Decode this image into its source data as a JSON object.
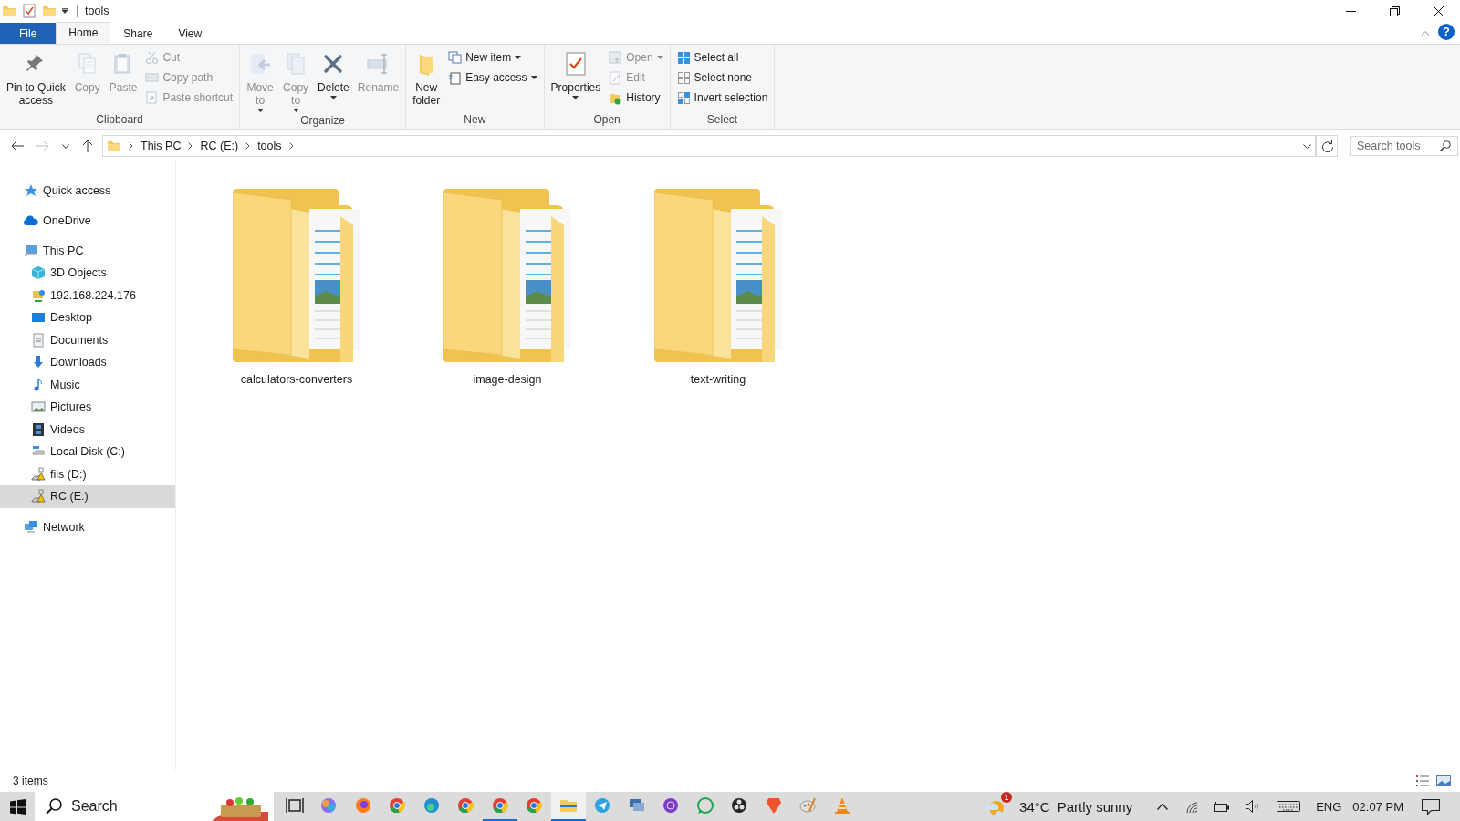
{
  "window": {
    "title": "tools"
  },
  "ribbon_tabs": [
    {
      "label": "File",
      "kind": "file",
      "selected": false
    },
    {
      "label": "Home",
      "kind": "tab",
      "selected": true
    },
    {
      "label": "Share",
      "kind": "tab",
      "selected": false
    },
    {
      "label": "View",
      "kind": "tab",
      "selected": false
    }
  ],
  "help_button": {
    "label": "?"
  },
  "ribbon_groups": [
    {
      "label": "Clipboard",
      "items": [
        {
          "kind": "large",
          "label": "Pin to Quick\naccess",
          "disabled": false,
          "dropdown": false
        },
        {
          "kind": "large",
          "label": "Copy",
          "disabled": true,
          "dropdown": false
        },
        {
          "kind": "large",
          "label": "Paste",
          "disabled": true,
          "dropdown": false
        },
        {
          "kind": "stack",
          "items": [
            {
              "label": "Cut",
              "disabled": true,
              "dropdown": false
            },
            {
              "label": "Copy path",
              "disabled": true,
              "dropdown": false
            },
            {
              "label": "Paste shortcut",
              "disabled": true,
              "dropdown": false
            }
          ]
        }
      ]
    },
    {
      "label": "Organize",
      "items": [
        {
          "kind": "large",
          "label": "Move\nto",
          "disabled": true,
          "dropdown": true
        },
        {
          "kind": "large",
          "label": "Copy\nto",
          "disabled": true,
          "dropdown": true
        },
        {
          "kind": "large",
          "label": "Delete",
          "disabled": false,
          "dropdown": true
        },
        {
          "kind": "large",
          "label": "Rename",
          "disabled": true,
          "dropdown": false
        }
      ]
    },
    {
      "label": "New",
      "items": [
        {
          "kind": "large",
          "label": "New\nfolder",
          "disabled": false,
          "dropdown": false
        },
        {
          "kind": "stack",
          "items": [
            {
              "label": "New item",
              "disabled": false,
              "dropdown": true
            },
            {
              "label": "Easy access",
              "disabled": false,
              "dropdown": true
            }
          ]
        }
      ]
    },
    {
      "label": "Open",
      "items": [
        {
          "kind": "large",
          "label": "Properties",
          "disabled": false,
          "dropdown": true
        },
        {
          "kind": "stack",
          "items": [
            {
              "label": "Open",
              "disabled": true,
              "dropdown": true
            },
            {
              "label": "Edit",
              "disabled": true,
              "dropdown": false
            },
            {
              "label": "History",
              "disabled": false,
              "dropdown": false
            }
          ]
        }
      ]
    },
    {
      "label": "Select",
      "items": [
        {
          "kind": "stack",
          "items": [
            {
              "label": "Select all",
              "disabled": false,
              "dropdown": false
            },
            {
              "label": "Select none",
              "disabled": false,
              "dropdown": false
            },
            {
              "label": "Invert selection",
              "disabled": false,
              "dropdown": false
            }
          ]
        }
      ]
    }
  ],
  "navigation": {
    "back_disabled": false,
    "forward_disabled": true
  },
  "breadcrumb": [
    "This PC",
    "RC (E:)",
    "tools"
  ],
  "search": {
    "placeholder": "Search tools"
  },
  "sidebar": {
    "items": [
      {
        "label": "Quick access",
        "selected": false
      },
      {
        "label": "OneDrive",
        "selected": false
      },
      {
        "label": "This PC",
        "selected": false,
        "children": [
          {
            "label": "3D Objects",
            "selected": false
          },
          {
            "label": "192.168.224.176",
            "selected": false
          },
          {
            "label": "Desktop",
            "selected": false
          },
          {
            "label": "Documents",
            "selected": false
          },
          {
            "label": "Downloads",
            "selected": false
          },
          {
            "label": "Music",
            "selected": false
          },
          {
            "label": "Pictures",
            "selected": false
          },
          {
            "label": "Videos",
            "selected": false
          },
          {
            "label": "Local Disk (C:)",
            "selected": false
          },
          {
            "label": "fils (D:)",
            "selected": false
          },
          {
            "label": "RC (E:)",
            "selected": true
          }
        ]
      },
      {
        "label": "Network",
        "selected": false
      }
    ]
  },
  "folders": [
    {
      "name": "calculators-converters",
      "selected": false
    },
    {
      "name": "image-design",
      "selected": false
    },
    {
      "name": "text-writing",
      "selected": false
    }
  ],
  "status_bar": {
    "item_count": "3 items"
  },
  "taskbar": {
    "search_placeholder": "Search",
    "apps": [
      {
        "kind": "taskview",
        "running": false,
        "active": false
      },
      {
        "kind": "copilot",
        "running": false,
        "active": false
      },
      {
        "kind": "firefox",
        "running": false,
        "active": false
      },
      {
        "kind": "chrome",
        "running": false,
        "active": false
      },
      {
        "kind": "edge",
        "running": false,
        "active": false
      },
      {
        "kind": "chrome",
        "running": false,
        "active": false
      },
      {
        "kind": "chrome",
        "running": true,
        "active": false
      },
      {
        "kind": "chrome",
        "running": false,
        "active": false
      },
      {
        "kind": "explorer",
        "running": true,
        "active": true
      },
      {
        "kind": "telegram",
        "running": false,
        "active": false
      },
      {
        "kind": "netapp",
        "running": false,
        "active": false
      },
      {
        "kind": "tor",
        "running": false,
        "active": false
      },
      {
        "kind": "whatsapp",
        "running": false,
        "active": false
      },
      {
        "kind": "obs",
        "running": false,
        "active": false
      },
      {
        "kind": "brave",
        "running": false,
        "active": false
      },
      {
        "kind": "paint",
        "running": false,
        "active": false
      },
      {
        "kind": "vlc",
        "running": false,
        "active": false
      }
    ],
    "weather": {
      "badge": "1",
      "temperature": "34°C",
      "condition": "Partly sunny"
    },
    "language": "ENG",
    "time": "02:07 PM"
  }
}
